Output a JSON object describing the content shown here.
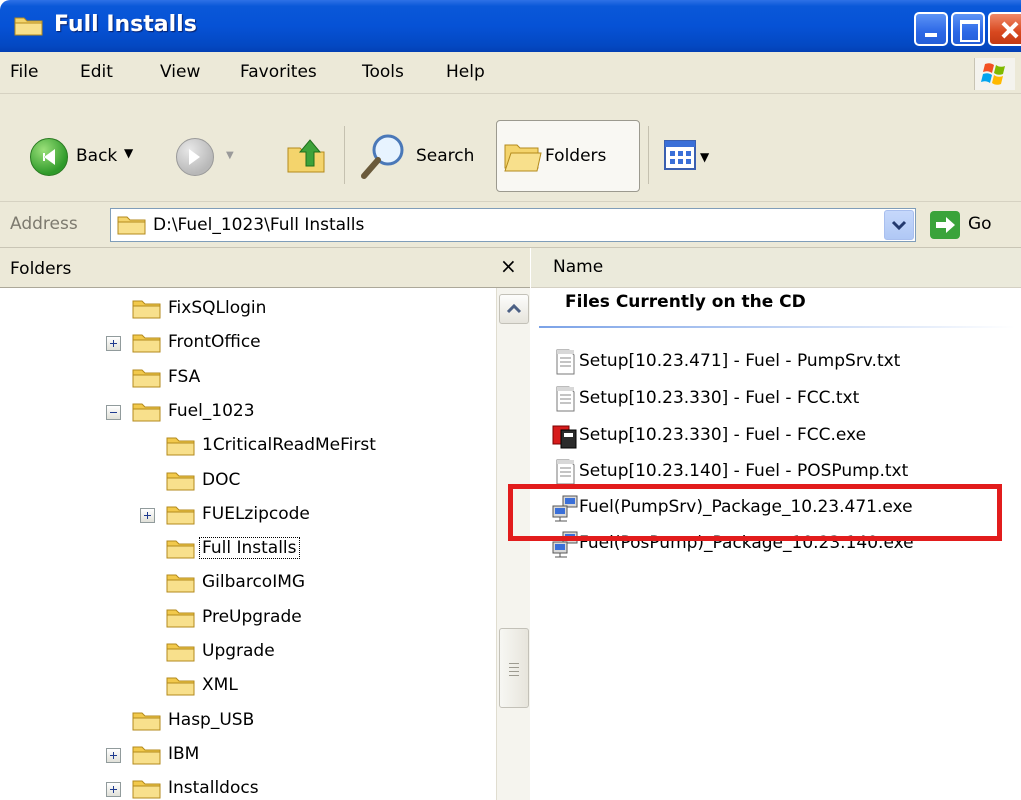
{
  "window": {
    "title": "Full Installs"
  },
  "menu": {
    "items": [
      "File",
      "Edit",
      "View",
      "Favorites",
      "Tools",
      "Help"
    ]
  },
  "toolbar": {
    "back_label": "Back",
    "search_label": "Search",
    "folders_label": "Folders"
  },
  "address": {
    "label": "Address",
    "path": "D:\\Fuel_1023\\Full Installs",
    "go_label": "Go"
  },
  "folders_pane": {
    "title": "Folders",
    "close_glyph": "×",
    "tree": [
      {
        "label": "FixSQLlogin",
        "level": 1,
        "expander": "none"
      },
      {
        "label": "FrontOffice",
        "level": 1,
        "expander": "plus"
      },
      {
        "label": "FSA",
        "level": 1,
        "expander": "none"
      },
      {
        "label": "Fuel_1023",
        "level": 1,
        "expander": "minus"
      },
      {
        "label": "1CriticalReadMeFirst",
        "level": 2,
        "expander": "none"
      },
      {
        "label": "DOC",
        "level": 2,
        "expander": "none"
      },
      {
        "label": "FUELzipcode",
        "level": 2,
        "expander": "plus"
      },
      {
        "label": "Full Installs",
        "level": 2,
        "expander": "none",
        "selected": true
      },
      {
        "label": "GilbarcoIMG",
        "level": 2,
        "expander": "none"
      },
      {
        "label": "PreUpgrade",
        "level": 2,
        "expander": "none"
      },
      {
        "label": "Upgrade",
        "level": 2,
        "expander": "none"
      },
      {
        "label": "XML",
        "level": 2,
        "expander": "none"
      },
      {
        "label": "Hasp_USB",
        "level": 1,
        "expander": "none"
      },
      {
        "label": "IBM",
        "level": 1,
        "expander": "plus"
      },
      {
        "label": "Installdocs",
        "level": 1,
        "expander": "plus"
      }
    ]
  },
  "file_list": {
    "column_name": "Name",
    "group_title": "Files Currently on the CD",
    "files": [
      {
        "name": "Setup[10.23.471] - Fuel - PumpSrv.txt",
        "icon": "text-file-icon"
      },
      {
        "name": "Setup[10.23.330] - Fuel - FCC.txt",
        "icon": "text-file-icon"
      },
      {
        "name": "Setup[10.23.330] - Fuel - FCC.exe",
        "icon": "setup-exe-icon"
      },
      {
        "name": "Setup[10.23.140] - Fuel - POSPump.txt",
        "icon": "text-file-icon"
      },
      {
        "name": "Fuel(PumpSrv)_Package_10.23.471.exe",
        "icon": "network-exe-icon",
        "highlighted": true
      },
      {
        "name": "Fuel(PosPump)_Package_10.23.140.exe",
        "icon": "network-exe-icon"
      }
    ]
  },
  "colors": {
    "titlebar": "#0652d6",
    "chrome": "#ece9d8",
    "highlight": "#e21c1c",
    "folder": "#f2c94c"
  }
}
